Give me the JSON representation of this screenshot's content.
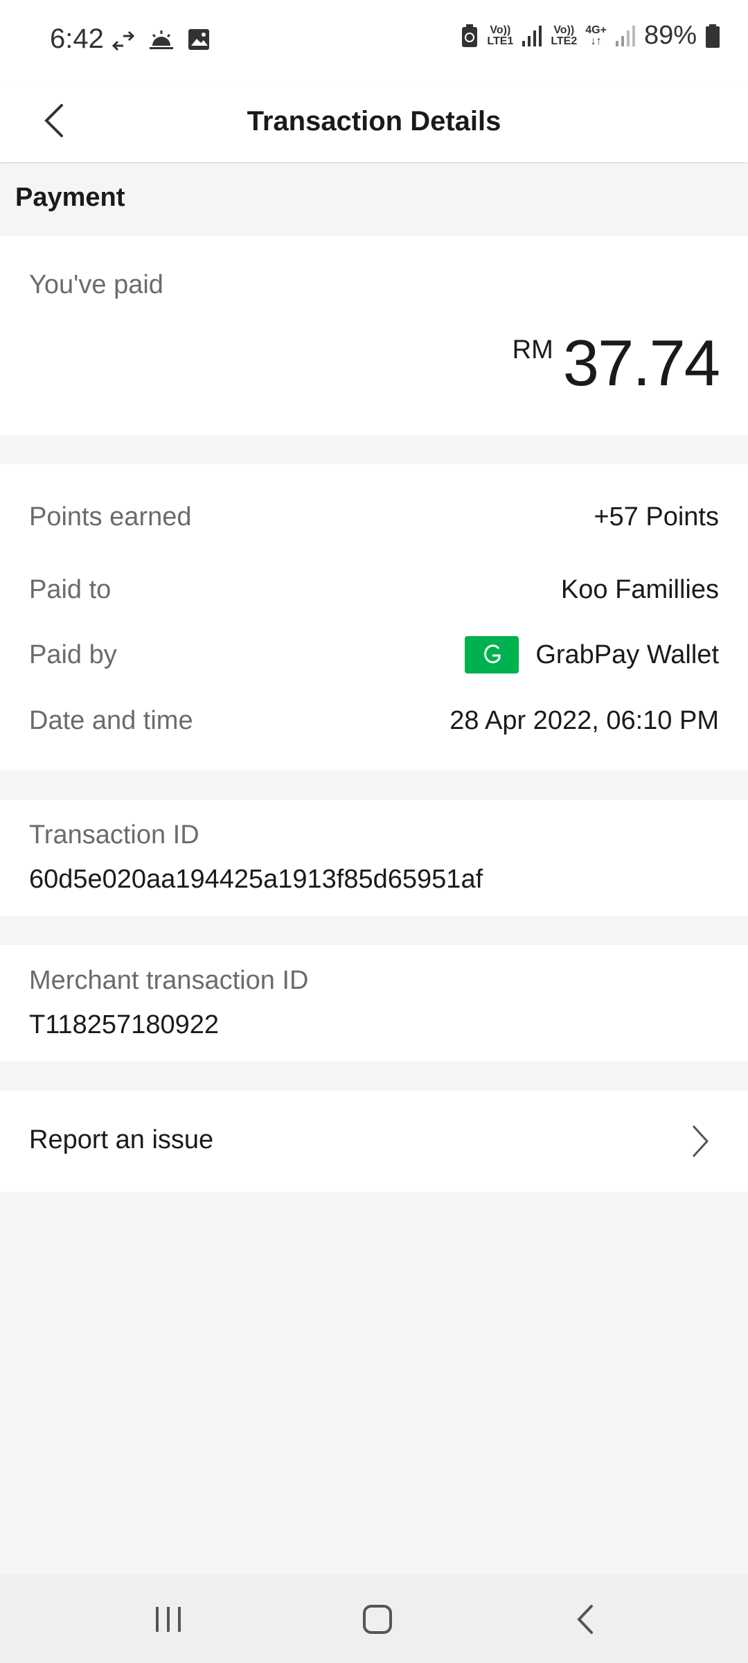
{
  "status_bar": {
    "time": "6:42",
    "battery": "89%",
    "sim1_label": "LTE1",
    "sim2_label": "LTE2",
    "volte_label": "Vo))",
    "network_label": "4G+"
  },
  "header": {
    "title": "Transaction Details"
  },
  "section": {
    "title": "Payment"
  },
  "paid": {
    "label": "You've paid",
    "currency": "RM",
    "amount": "37.74"
  },
  "details": {
    "points_label": "Points earned",
    "points_value": "+57 Points",
    "paid_to_label": "Paid to",
    "paid_to_value": "Koo Famillies",
    "paid_by_label": "Paid by",
    "paid_by_value": "GrabPay Wallet",
    "date_label": "Date and time",
    "date_value": "28 Apr 2022, 06:10 PM"
  },
  "transaction": {
    "label": "Transaction ID",
    "value": "60d5e020aa194425a1913f85d65951af"
  },
  "merchant": {
    "label": "Merchant transaction ID",
    "value": "T118257180922"
  },
  "report": {
    "label": "Report an issue"
  },
  "colors": {
    "grab_green": "#00b14f",
    "background": "#f5f5f5"
  }
}
